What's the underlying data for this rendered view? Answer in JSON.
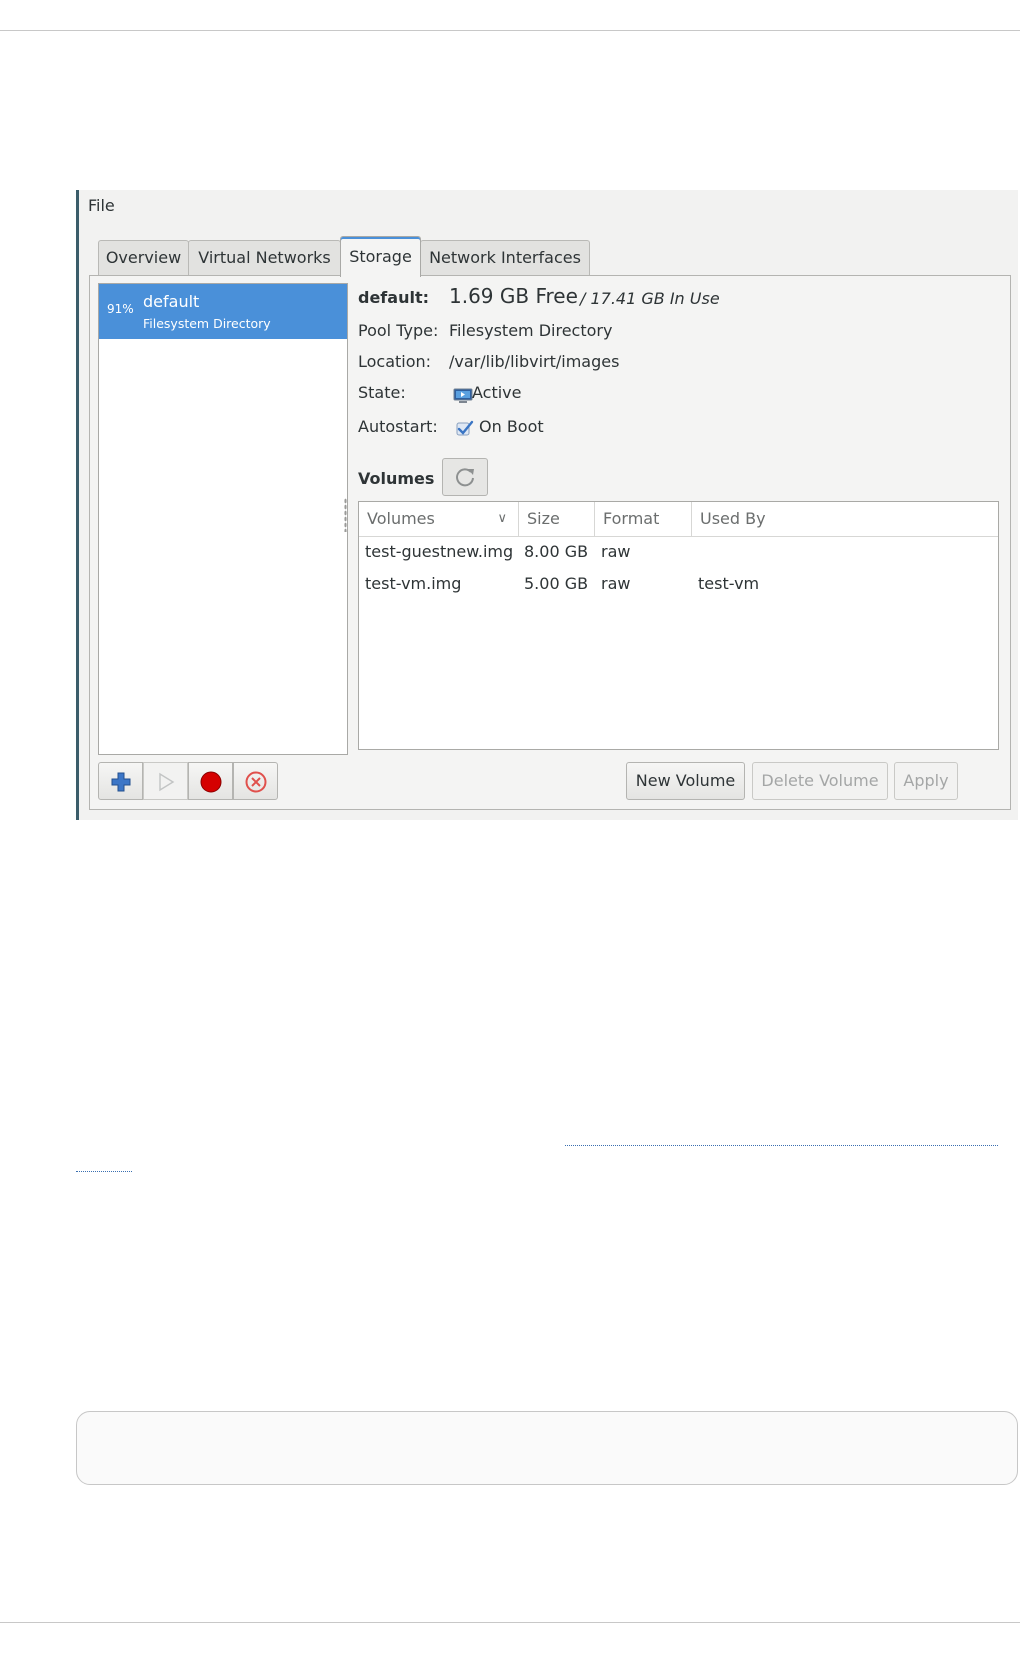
{
  "window": {
    "menu": {
      "file_label": "File"
    },
    "tabs": [
      "Overview",
      "Virtual Networks",
      "Storage",
      "Network Interfaces"
    ],
    "active_tab": "Storage",
    "pool_list": [
      {
        "percent": "91%",
        "name": "default",
        "type": "Filesystem Directory",
        "selected": true
      }
    ],
    "details": {
      "name_label": "default:",
      "free": "1.69 GB Free",
      "in_use": "/ 17.41 GB In Use",
      "pool_type_label": "Pool Type:",
      "pool_type_value": "Filesystem Directory",
      "location_label": "Location:",
      "location_value": "/var/lib/libvirt/images",
      "state_label": "State:",
      "state_value": "Active",
      "autostart_label": "Autostart:",
      "autostart_value": "On Boot",
      "volumes_label": "Volumes"
    },
    "volumes_table": {
      "columns": [
        "Volumes",
        "Size",
        "Format",
        "Used By"
      ],
      "rows": [
        {
          "name": "test-guestnew.img",
          "size": "8.00 GB",
          "format": "raw",
          "used_by": ""
        },
        {
          "name": "test-vm.img",
          "size": "5.00 GB",
          "format": "raw",
          "used_by": "test-vm"
        }
      ]
    },
    "buttons": {
      "new_volume": "New Volume",
      "delete_volume": "Delete Volume",
      "apply": "Apply"
    },
    "icons": {
      "add": "add-pool-icon",
      "start": "start-pool-icon",
      "stop": "stop-pool-icon",
      "delete": "delete-pool-icon",
      "refresh": "refresh-icon",
      "state": "monitor-icon",
      "autostart": "checkbox-checked-icon"
    },
    "colors": {
      "selection": "#4a90d9",
      "stop_red": "#d50000",
      "delete_red": "#e0504c"
    }
  }
}
